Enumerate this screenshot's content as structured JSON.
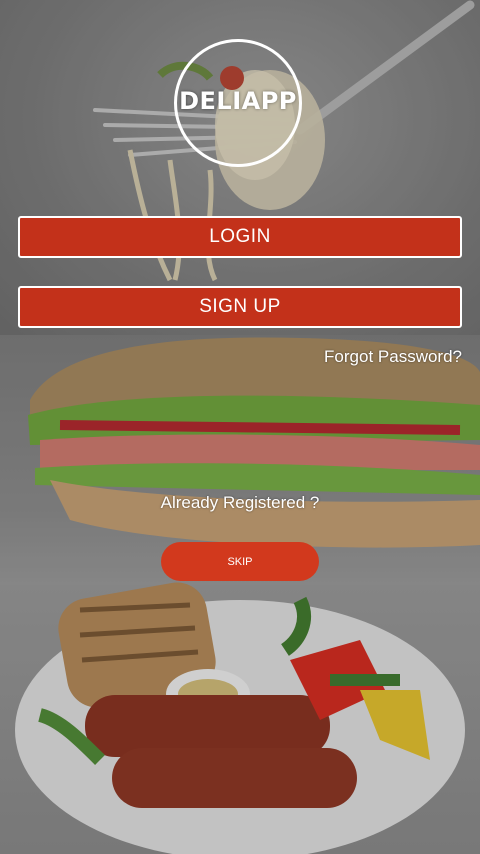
{
  "app": {
    "logo_text": "DELIAPP"
  },
  "actions": {
    "login_label": "LOGIN",
    "signup_label": "SIGN UP",
    "forgot_password_label": "Forgot Password?",
    "already_registered_label": "Already Registered ?",
    "skip_label": "SKIP"
  },
  "colors": {
    "accent": "#c3311a",
    "skip_accent": "#d2391d",
    "text": "#ffffff"
  },
  "background_images": [
    "pasta-on-fork",
    "sub-sandwich",
    "sausage-breakfast-plate"
  ]
}
